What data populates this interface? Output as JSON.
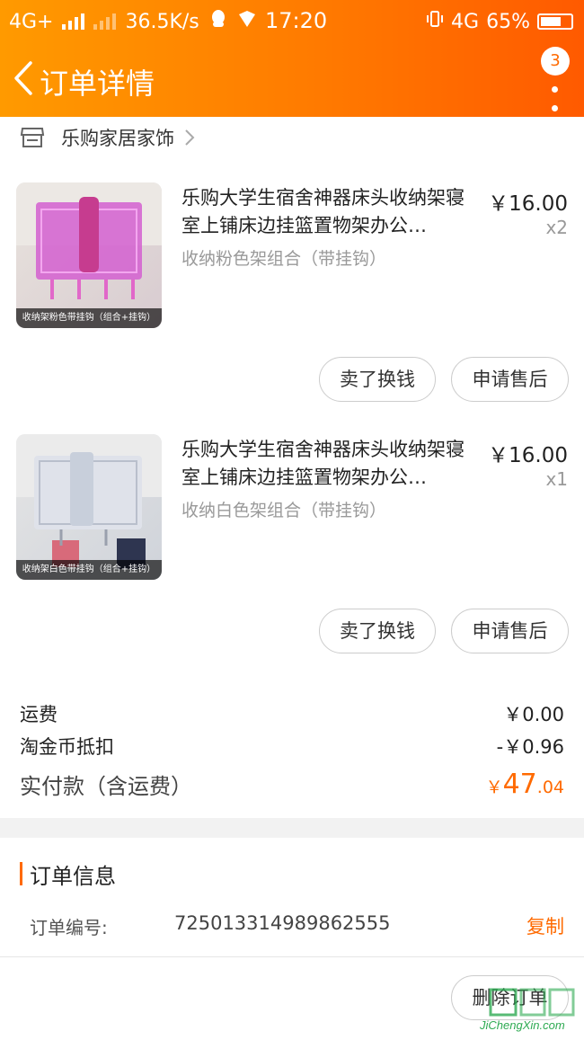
{
  "status_bar": {
    "network_left": "4G+",
    "speed": "36.5K/s",
    "time": "17:20",
    "network_right": "4G",
    "battery": "65%"
  },
  "nav": {
    "title": "订单详情",
    "badge_count": "3"
  },
  "shop": {
    "name": "乐购家居家饰"
  },
  "items": [
    {
      "title": "乐购大学生宿舍神器床头收纳架寝室上铺床边挂篮置物架办公…",
      "sku": "收纳粉色架组合（带挂钩）",
      "price": "￥16.00",
      "qty": "x2",
      "thumb_caption": "收纳架粉色带挂钩（组合+挂钩）",
      "btn_sell": "卖了换钱",
      "btn_after_sale": "申请售后"
    },
    {
      "title": "乐购大学生宿舍神器床头收纳架寝室上铺床边挂篮置物架办公…",
      "sku": "收纳白色架组合（带挂钩）",
      "price": "￥16.00",
      "qty": "x1",
      "thumb_caption": "收纳架白色带挂钩（组合+挂钩）",
      "btn_sell": "卖了换钱",
      "btn_after_sale": "申请售后"
    }
  ],
  "summary": {
    "shipping_label": "运费",
    "shipping_value": "￥0.00",
    "coin_label": "淘金币抵扣",
    "coin_value": "-￥0.96",
    "paid_label": "实付款（含运费）",
    "paid_currency": "￥",
    "paid_int": "47",
    "paid_dec": ".04"
  },
  "order_info": {
    "section_title": "订单信息",
    "number_label": "订单编号:",
    "number_value": "725013314989862555",
    "copy_label": "复制",
    "delete_label": "删除订单"
  },
  "watermark": {
    "text": "JiChengXin.com"
  },
  "colors": {
    "accent": "#ff6a00",
    "header_start": "#ff9a00",
    "header_end": "#ff5a00"
  }
}
